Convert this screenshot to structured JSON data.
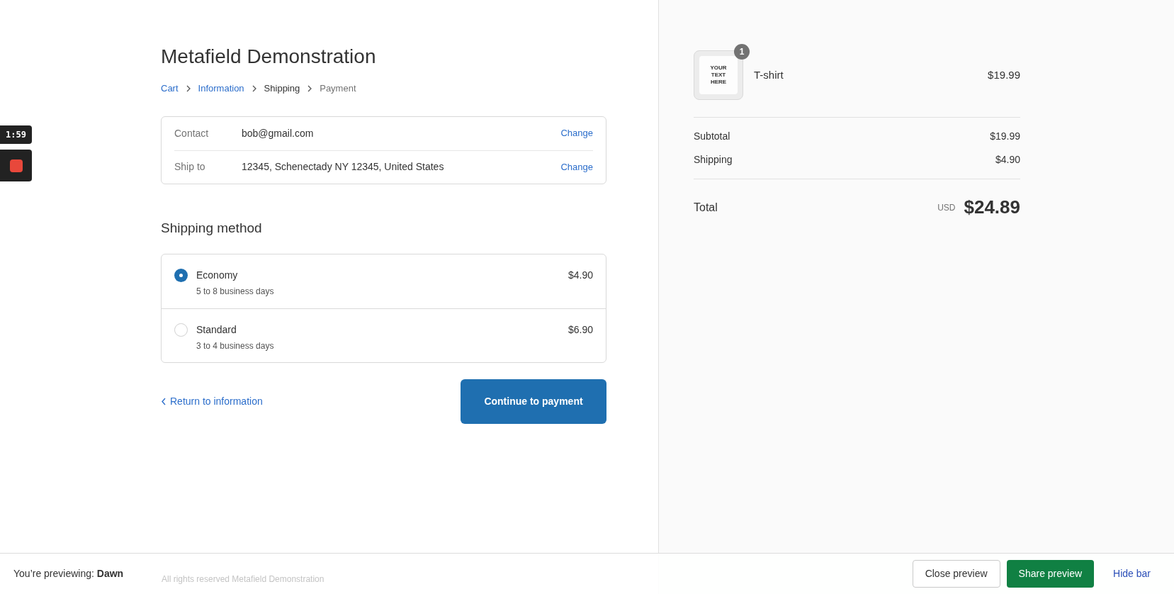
{
  "recorder": {
    "timer": "1:59"
  },
  "shop": {
    "title": "Metafield Demonstration"
  },
  "breadcrumbs": [
    {
      "label": "Cart",
      "kind": "link"
    },
    {
      "label": "Information",
      "kind": "link"
    },
    {
      "label": "Shipping",
      "kind": "current"
    },
    {
      "label": "Payment",
      "kind": "upcoming"
    }
  ],
  "review": [
    {
      "label": "Contact",
      "value": "bob@gmail.com",
      "action": "Change"
    },
    {
      "label": "Ship to",
      "value": "12345, Schenectady NY 12345, United States",
      "action": "Change"
    }
  ],
  "shipping_method": {
    "heading": "Shipping method",
    "options": [
      {
        "name": "Economy",
        "detail": "5 to 8 business days",
        "price": "$4.90",
        "selected": true
      },
      {
        "name": "Standard",
        "detail": "3 to 4 business days",
        "price": "$6.90",
        "selected": false
      }
    ]
  },
  "return_link": "Return to information",
  "continue_button": "Continue to payment",
  "footer": "All rights reserved Metafield Demonstration",
  "summary": {
    "items": [
      {
        "name": "T-shirt",
        "quantity": "1",
        "price": "$19.99",
        "image_text": "YOUR TEXT HERE"
      }
    ],
    "lines": [
      {
        "label": "Subtotal",
        "value": "$19.99"
      },
      {
        "label": "Shipping",
        "value": "$4.90"
      }
    ],
    "total": {
      "label": "Total",
      "currency": "USD",
      "value": "$24.89"
    }
  },
  "preview_bar": {
    "text": "You’re previewing: **Dawn**",
    "close": "Close preview",
    "share": "Share preview",
    "hide": "Hide bar"
  }
}
